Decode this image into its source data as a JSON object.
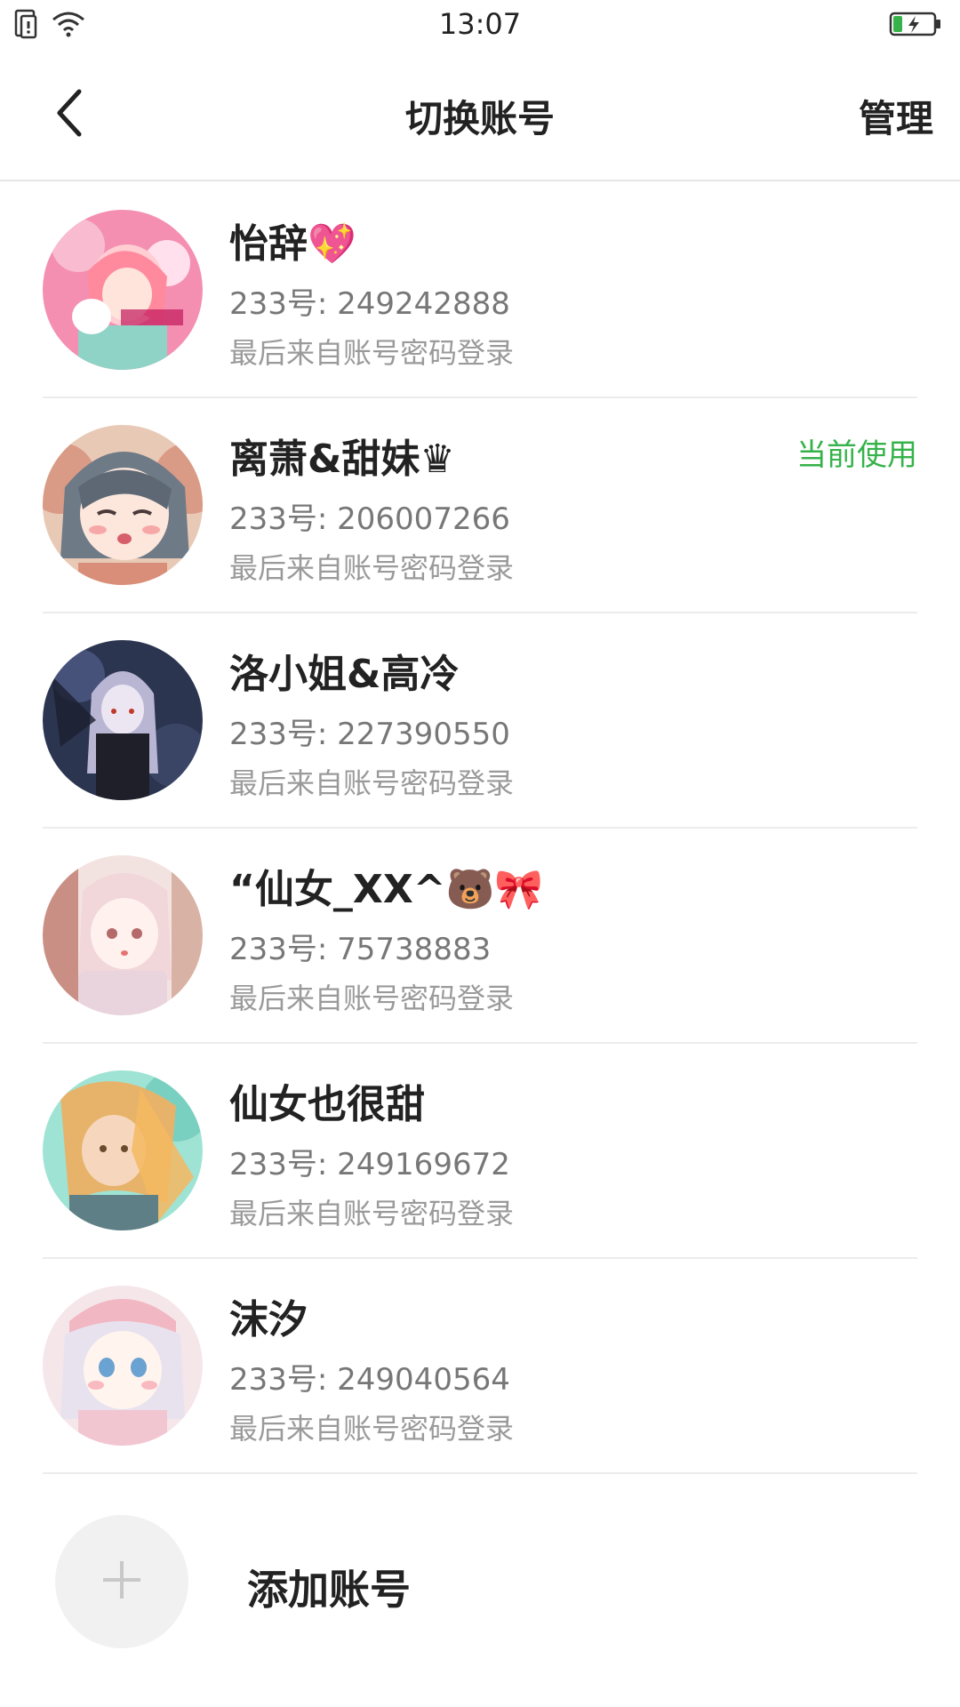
{
  "status_bar": {
    "time": "13:07"
  },
  "header": {
    "title": "切换账号",
    "manage_label": "管理"
  },
  "accounts": [
    {
      "name": "怡辞💖",
      "uid": "233号: 249242888",
      "login": "最后来自账号密码登录",
      "current": ""
    },
    {
      "name": "离萧&甜妹♛",
      "uid": "233号: 206007266",
      "login": "最后来自账号密码登录",
      "current": "当前使用"
    },
    {
      "name": "洛小姐&高冷",
      "uid": "233号: 227390550",
      "login": "最后来自账号密码登录",
      "current": ""
    },
    {
      "name": "“仙女_XX^🐻🎀",
      "uid": "233号: 75738883",
      "login": "最后来自账号密码登录",
      "current": ""
    },
    {
      "name": "仙女也很甜",
      "uid": "233号: 249169672",
      "login": "最后来自账号密码登录",
      "current": ""
    },
    {
      "name": "沫汐",
      "uid": "233号: 249040564",
      "login": "最后来自账号密码登录",
      "current": ""
    }
  ],
  "add_account": {
    "label": "添加账号"
  },
  "colors": {
    "accent_green": "#36b24a",
    "text_primary": "#222222",
    "text_secondary": "#777777",
    "divider": "#ececec"
  },
  "icons": {
    "back": "back-arrow-icon",
    "add": "plus-icon",
    "sim": "sim-card-icon",
    "wifi": "wifi-icon",
    "battery": "battery-charging-icon"
  }
}
